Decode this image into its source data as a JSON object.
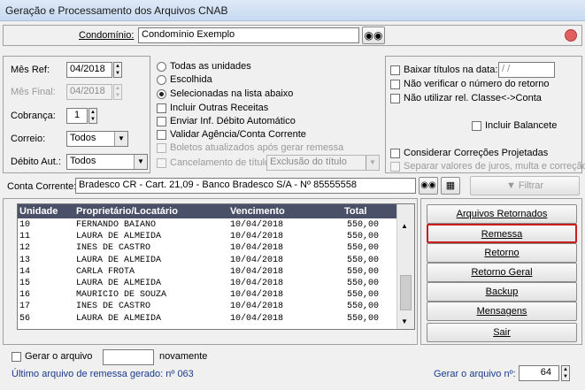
{
  "window": {
    "title": "Geração e Processamento dos Arquivos CNAB"
  },
  "condominio": {
    "label": "Condomínio:",
    "value": "Condomínio Exemplo"
  },
  "left": {
    "mes_ref": {
      "label": "Mês Ref:",
      "value": "04/2018"
    },
    "mes_final": {
      "label": "Mês Final:",
      "value": "04/2018"
    },
    "cobranca": {
      "label": "Cobrança:",
      "value": "1"
    },
    "correio": {
      "label": "Correio:",
      "value": "Todos"
    },
    "debito": {
      "label": "Débito Aut.:",
      "value": "Todos"
    }
  },
  "units_options": {
    "todas": "Todas as unidades",
    "escolhida": "Escolhida",
    "selecionadas": "Selecionadas na lista abaixo",
    "incluir_outras": "Incluir Outras Receitas",
    "enviar_inf": "Enviar Inf. Débito Automático",
    "validar": "Validar Agência/Conta Corrente",
    "boletos_atualizados": "Boletos atualizados após gerar remessa",
    "cancelamento": "Cancelamento de título",
    "exclusao": "Exclusão do título"
  },
  "right_options": {
    "baixar": "Baixar títulos na data:",
    "baixar_date": "/ /",
    "nao_verificar": "Não verificar o número do retorno",
    "nao_utilizar": "Não utilizar rel. Classe<->Conta",
    "incluir_balancete": "Incluir Balancete",
    "considerar": "Considerar Correções Projetadas",
    "separar": "Separar valores de juros, multa e correção"
  },
  "conta": {
    "label": "Conta Corrente:",
    "value": "Bradesco CR - Cart. 21,09 - Banco Bradesco S/A - Nº 85555558",
    "filtrar": "Filtrar"
  },
  "table": {
    "headers": [
      "Unidade",
      "Proprietário/Locatário",
      "Vencimento",
      "Total"
    ],
    "rows": [
      [
        "10",
        "FERNANDO BAIANO",
        "10/04/2018",
        "550,00"
      ],
      [
        "11",
        "LAURA DE ALMEIDA",
        "10/04/2018",
        "550,00"
      ],
      [
        "12",
        "INES DE CASTRO",
        "10/04/2018",
        "550,00"
      ],
      [
        "13",
        "LAURA DE ALMEIDA",
        "10/04/2018",
        "550,00"
      ],
      [
        "14",
        "CARLA FROTA",
        "10/04/2018",
        "550,00"
      ],
      [
        "15",
        "LAURA DE ALMEIDA",
        "10/04/2018",
        "550,00"
      ],
      [
        "16",
        "MAURICIO DE SOUZA",
        "10/04/2018",
        "550,00"
      ],
      [
        "17",
        "INES DE CASTRO",
        "10/04/2018",
        "550,00"
      ],
      [
        "56",
        "LAURA DE ALMEIDA",
        "10/04/2018",
        "550,00"
      ]
    ]
  },
  "buttons": {
    "arquivos_retornados": "Arquivos Retornados",
    "remessa": "Remessa",
    "retorno": "Retorno",
    "retorno_geral": "Retorno Geral",
    "backup": "Backup",
    "mensagens": "Mensagens",
    "sair": "Sair"
  },
  "footer": {
    "gerar_o_arquivo": "Gerar o arquivo",
    "novamente": "novamente",
    "ultimo": "Último arquivo de remessa gerado: nº 063",
    "gerar_n_label": "Gerar o arquivo nº:",
    "gerar_n_value": "64"
  }
}
